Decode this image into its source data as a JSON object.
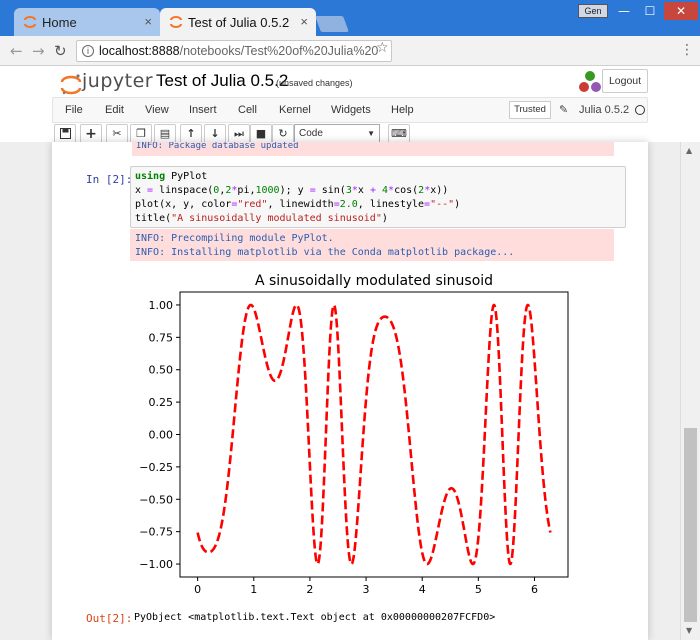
{
  "browser": {
    "tabs": [
      {
        "label": "Home",
        "close": "×"
      },
      {
        "label": "Test of Julia 0.5.2",
        "close": "×"
      }
    ],
    "window_user": "Gen",
    "window_controls": {
      "minimize": "—",
      "maximize": "☐",
      "close": "✕"
    },
    "url_host": "localhost:8888",
    "url_path": "/notebooks/Test%20of%20Julia%20",
    "icons": [
      "back-icon",
      "forward-icon",
      "reload-icon",
      "info-icon",
      "star-icon",
      "menu-icon"
    ]
  },
  "jupyter": {
    "logo_text": "jupyter",
    "notebook_title": "Test of Julia 0.5.2",
    "save_status": "(unsaved changes)",
    "logout_label": "Logout",
    "menu": [
      "File",
      "Edit",
      "View",
      "Insert",
      "Cell",
      "Kernel",
      "Widgets",
      "Help"
    ],
    "trusted_label": "Trusted",
    "kernel_name": "Julia 0.5.2",
    "cell_type": "Code",
    "toolbar_icons": [
      "save-icon",
      "plus-icon",
      "cut-icon",
      "copy-icon",
      "paste-icon",
      "arrow-up-icon",
      "arrow-down-icon",
      "run-icon",
      "stop-icon",
      "restart-icon",
      "keyboard-icon"
    ]
  },
  "notebook": {
    "prev_output": "INFO: Package database updated",
    "in_prompt": "In [2]:",
    "code": [
      "using PyPlot",
      "x = linspace(0,2*pi,1000); y = sin(3*x + 4*cos(2*x))",
      "plot(x, y, color=\"red\", linewidth=2.0, linestyle=\"--\")",
      "title(\"A sinusoidally modulated sinusoid\")"
    ],
    "stderr": [
      "INFO: Precompiling module PyPlot.",
      "INFO: Installing matplotlib via the Conda matplotlib package..."
    ],
    "out_prompt": "Out[2]:",
    "out_text": "PyObject <matplotlib.text.Text object at 0x00000000207FCFD0>"
  },
  "chart_data": {
    "type": "line",
    "title": "A sinusoidally modulated sinusoid",
    "function": "y = sin(3*x + 4*cos(2*x))",
    "x_range": [
      0,
      6.283185307
    ],
    "samples": 1000,
    "series": [
      {
        "color": "#ff0000",
        "linestyle": "dashed",
        "linewidth": 2.0
      }
    ],
    "xlim": [
      -0.314,
      6.597
    ],
    "ylim": [
      -1.1,
      1.1
    ],
    "xticks": [
      "0",
      "1",
      "2",
      "3",
      "4",
      "5",
      "6"
    ],
    "yticks": [
      "1.00",
      "0.75",
      "0.50",
      "0.25",
      "0.00",
      "−0.25",
      "−0.50",
      "−0.75",
      "−1.00"
    ],
    "grid": false,
    "xlabel": "",
    "ylabel": ""
  }
}
